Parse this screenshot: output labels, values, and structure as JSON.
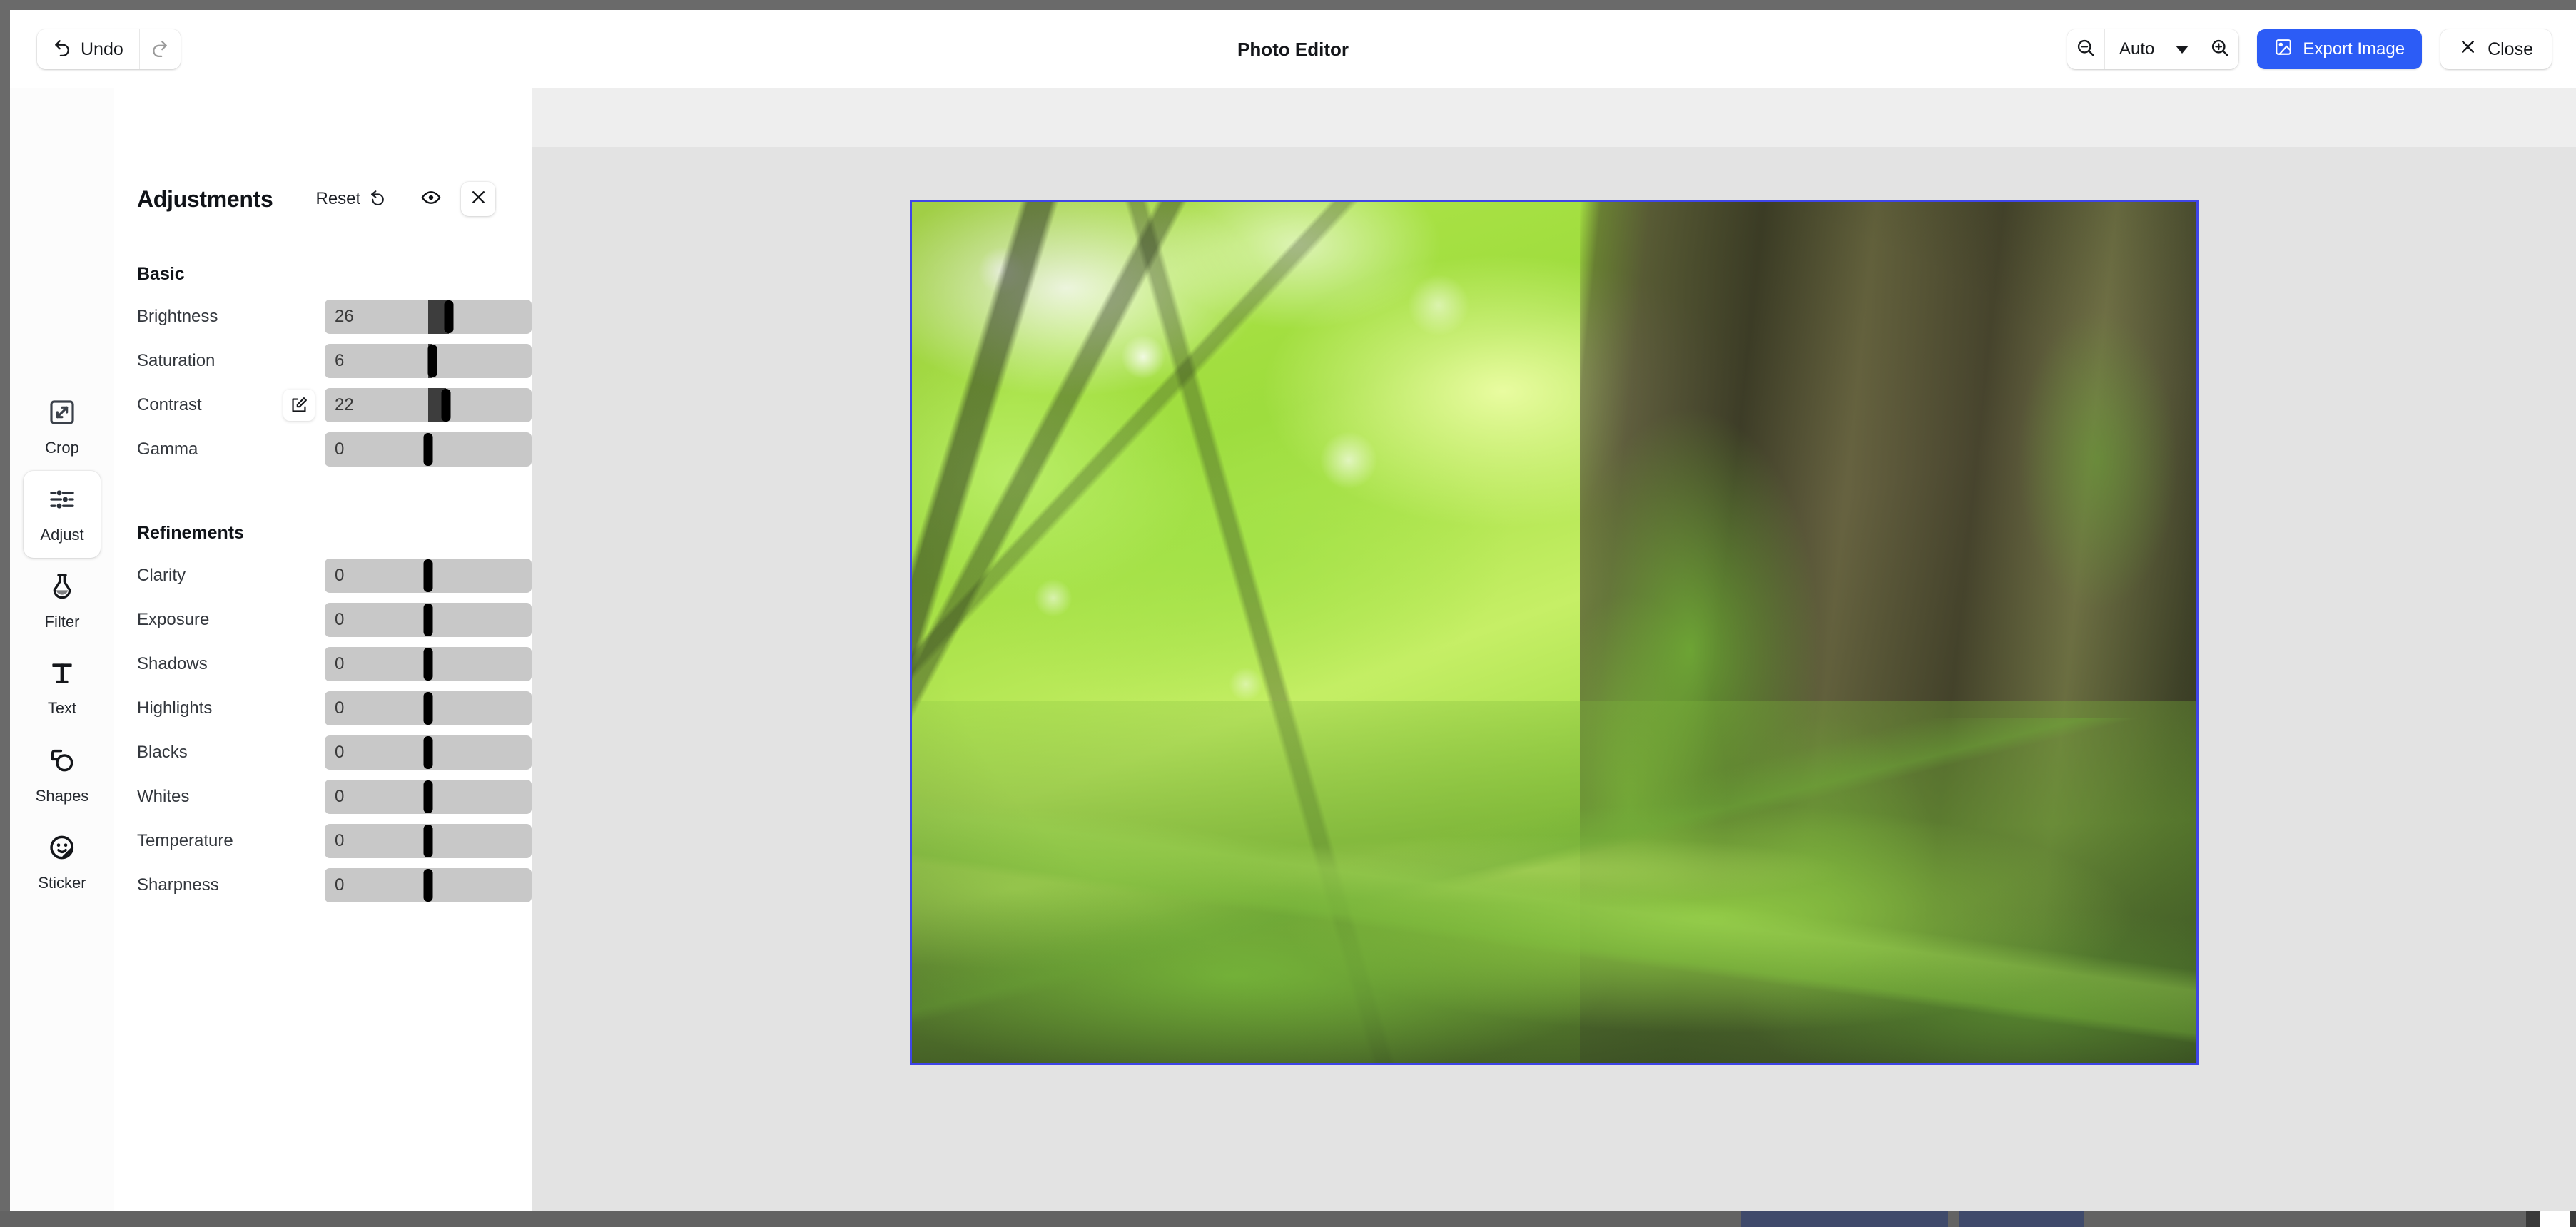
{
  "app": {
    "title": "Photo Editor"
  },
  "topbar": {
    "undo_label": "Undo",
    "undo_icon": "undo-arrow-icon",
    "redo_icon": "redo-arrow-icon",
    "zoom_out_icon": "zoom-out-icon",
    "zoom_in_icon": "zoom-in-icon",
    "zoom_level": "Auto",
    "export_label": "Export Image",
    "export_icon": "image-icon",
    "export_color": "#2c5cf6",
    "close_label": "Close",
    "close_icon": "close-x-icon"
  },
  "tool_rail": {
    "items": [
      {
        "label": "Crop",
        "icon": "crop-expand-icon",
        "active": false
      },
      {
        "label": "Adjust",
        "icon": "sliders-icon",
        "active": true
      },
      {
        "label": "Filter",
        "icon": "flask-icon",
        "active": false
      },
      {
        "label": "Text",
        "icon": "text-t-icon",
        "active": false
      },
      {
        "label": "Shapes",
        "icon": "shapes-icon",
        "active": false
      },
      {
        "label": "Sticker",
        "icon": "sticker-smiley-icon",
        "active": false
      }
    ]
  },
  "panel": {
    "title": "Adjustments",
    "reset_label": "Reset",
    "reset_icon": "reset-rotate-icon",
    "preview_icon": "eye-icon",
    "close_icon": "close-x-icon",
    "sections": [
      {
        "title": "Basic",
        "sliders": [
          {
            "label": "Brightness",
            "value": "26",
            "percent": 60.0,
            "edit_icon": false
          },
          {
            "label": "Saturation",
            "value": "6",
            "percent": 52.0,
            "edit_icon": false
          },
          {
            "label": "Contrast",
            "value": "22",
            "percent": 58.5,
            "edit_icon": true,
            "edit_icon_name": "edit-pencil-icon"
          },
          {
            "label": "Gamma",
            "value": "0",
            "percent": 50.0,
            "edit_icon": false
          }
        ]
      },
      {
        "title": "Refinements",
        "sliders": [
          {
            "label": "Clarity",
            "value": "0",
            "percent": 50.0,
            "edit_icon": false
          },
          {
            "label": "Exposure",
            "value": "0",
            "percent": 50.0,
            "edit_icon": false
          },
          {
            "label": "Shadows",
            "value": "0",
            "percent": 50.0,
            "edit_icon": false
          },
          {
            "label": "Highlights",
            "value": "0",
            "percent": 50.0,
            "edit_icon": false
          },
          {
            "label": "Blacks",
            "value": "0",
            "percent": 50.0,
            "edit_icon": false
          },
          {
            "label": "Whites",
            "value": "0",
            "percent": 50.0,
            "edit_icon": false
          },
          {
            "label": "Temperature",
            "value": "0",
            "percent": 50.0,
            "edit_icon": false
          },
          {
            "label": "Sharpness",
            "value": "0",
            "percent": 50.0,
            "edit_icon": false
          }
        ]
      }
    ]
  },
  "canvas": {
    "photo_alt": "forest-tree-trunk-moss-photo",
    "selection_color": "#3f45e8"
  }
}
